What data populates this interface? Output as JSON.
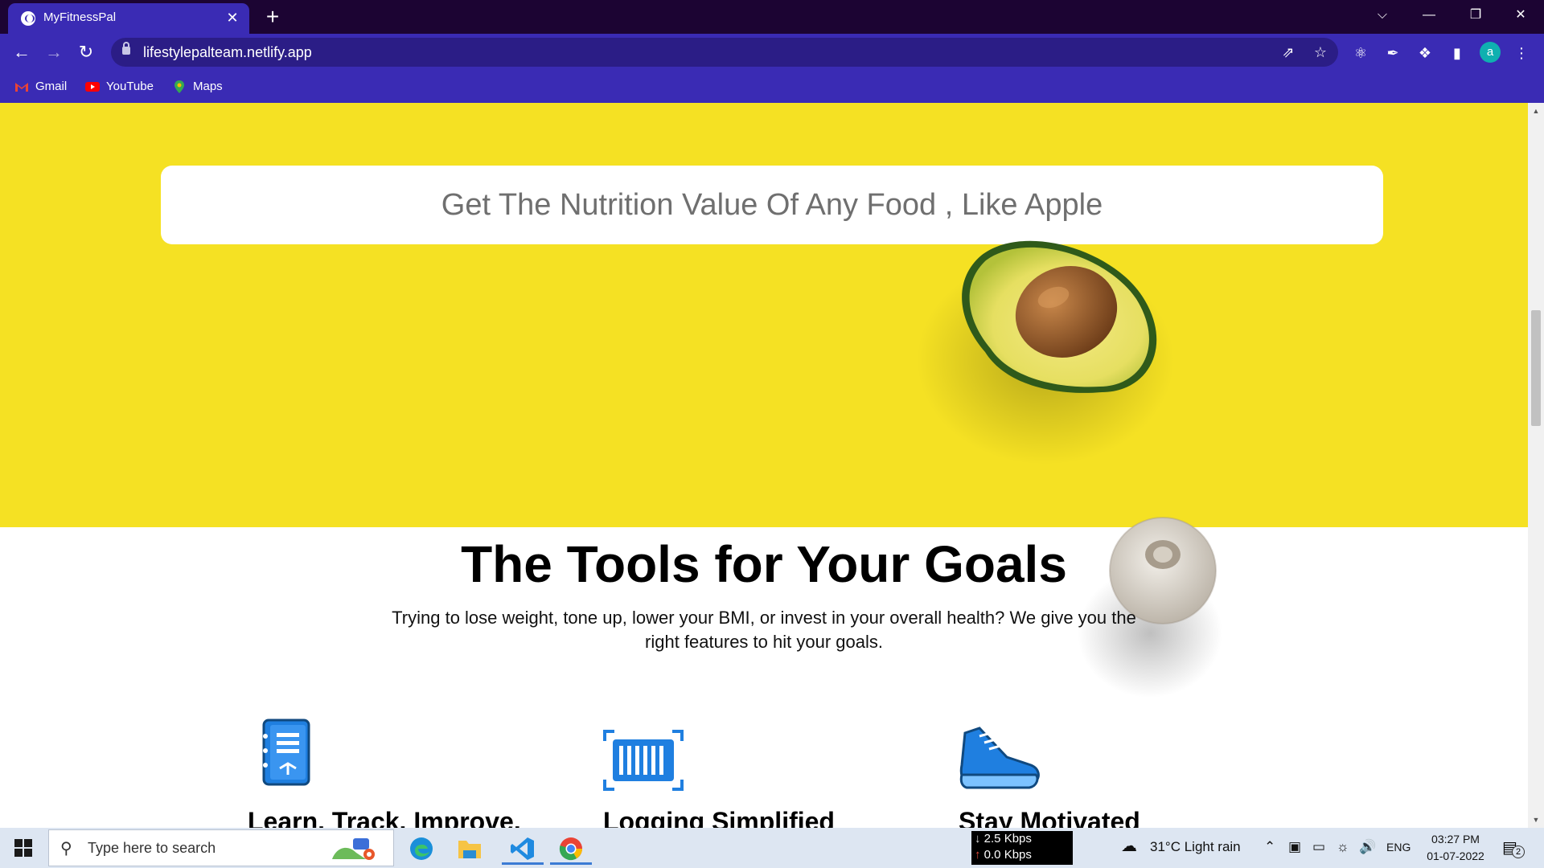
{
  "browser": {
    "tab_title": "MyFitnessPal",
    "tab_close": "✕",
    "new_tab": "+",
    "url": "lifestylepalteam.netlify.app",
    "avatar_letter": "a",
    "window_controls": {
      "dropdown": "⌵",
      "minimize": "—",
      "restore": "❐",
      "close": "✕"
    }
  },
  "bookmarks": [
    {
      "label": "Gmail"
    },
    {
      "label": "YouTube"
    },
    {
      "label": "Maps"
    }
  ],
  "hero": {
    "search_placeholder": "Get The Nutrition Value Of Any Food , Like Apple"
  },
  "tools_section": {
    "title": "The Tools for Your Goals",
    "description": "Trying to lose weight, tone up, lower your BMI, or invest in your overall health? We give you the right features to hit your goals."
  },
  "features": [
    {
      "title": "Learn. Track. Improve.",
      "icon": "journal-icon"
    },
    {
      "title": "Logging Simplified",
      "icon": "barcode-scanner-icon"
    },
    {
      "title": "Stay Motivated",
      "icon": "sneaker-icon"
    }
  ],
  "taskbar": {
    "search_placeholder": "Type here to search",
    "net_down": "2.5 Kbps",
    "net_up": "0.0 Kbps",
    "weather": "31°C  Light rain",
    "language": "ENG",
    "time": "03:27 PM",
    "date": "01-07-2022",
    "notification_count": "2"
  },
  "colors": {
    "tab_strip": "#1c0433",
    "browser_accent": "#3a2bb4",
    "hero_yellow": "#f5e123",
    "icon_blue": "#1f7fe0"
  }
}
